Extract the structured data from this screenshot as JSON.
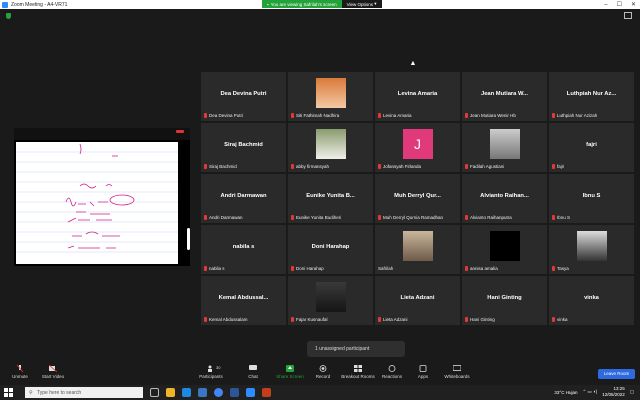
{
  "window": {
    "title": "Zoom Meeting - A4-VR71"
  },
  "banner": {
    "viewing": "You are viewing Safrilah's screen",
    "view_options": "View Options"
  },
  "participants": [
    {
      "tile": "Dea Devina Putri",
      "caption": "Dea Devina Putri",
      "muted": true
    },
    {
      "tile": "",
      "caption": "Siti Fathimah Nadhira",
      "muted": true,
      "photo": "anime"
    },
    {
      "tile": "Levina Amaria",
      "caption": "Levina Amaria",
      "muted": true
    },
    {
      "tile": "Jean Mutiara W...",
      "caption": "Jean Mutiara Wenir Hb",
      "muted": true
    },
    {
      "tile": "Luthpiah Nur Az...",
      "caption": "Luthpiah Nur Azizah",
      "muted": true
    },
    {
      "tile": "Siraj Bachmid",
      "caption": "Siraj Bachmid",
      "muted": true
    },
    {
      "tile": "",
      "caption": "abby firmansyah",
      "muted": true,
      "photo": "person"
    },
    {
      "tile": "",
      "caption": "Jofansyah Firlanda",
      "muted": true,
      "photo": "letter",
      "letter": "J"
    },
    {
      "tile": "",
      "caption": "Fadilah Agustiani",
      "muted": true,
      "photo": "room"
    },
    {
      "tile": "fajri",
      "caption": "fajri",
      "muted": true
    },
    {
      "tile": "Andri Darmawan",
      "caption": "Andri Darmawan",
      "muted": true
    },
    {
      "tile": "Eunike Yunita B...",
      "caption": "Eunike Yunita Budiheri",
      "muted": true
    },
    {
      "tile": "Muh Derryl Qur...",
      "caption": "Muh Derryl Qurnia Ramadhan",
      "muted": true
    },
    {
      "tile": "Alvianto Raihan...",
      "caption": "Alvianto Raihanputra",
      "muted": true
    },
    {
      "tile": "Ibnu S",
      "caption": "Ibnu S",
      "muted": true
    },
    {
      "tile": "nabila s",
      "caption": "nabila s",
      "muted": true
    },
    {
      "tile": "Doni Harahap",
      "caption": "Doni Harahap",
      "muted": true
    },
    {
      "tile": "",
      "caption": "Safrilah",
      "muted": false,
      "photo": "street"
    },
    {
      "tile": "",
      "caption": "annisa amalia",
      "muted": true,
      "photo": "black"
    },
    {
      "tile": "",
      "caption": "Tasya",
      "muted": true,
      "photo": "group"
    },
    {
      "tile": "Kemal Abdussal...",
      "caption": "Kemal Abdussalam",
      "muted": true
    },
    {
      "tile": "",
      "caption": "Fajar Kusnaufal",
      "muted": true,
      "photo": "dark"
    },
    {
      "tile": "Lieta Adzani",
      "caption": "Lieta Adzani",
      "muted": true
    },
    {
      "tile": "Hani Ginting",
      "caption": "Hani Ginting",
      "muted": true
    },
    {
      "tile": "vinka",
      "caption": "vinka",
      "muted": true
    }
  ],
  "popup": {
    "text": "1 unassigned participant"
  },
  "toolbar": {
    "unmute": "Unmute",
    "start_video": "Start Video",
    "participants": "Participants",
    "participants_count": "30",
    "chat": "Chat",
    "share_screen": "Share Screen",
    "record": "Record",
    "breakout_rooms": "Breakout Rooms",
    "reactions": "Reactions",
    "apps": "Apps",
    "whiteboards": "Whiteboards",
    "leave": "Leave Room"
  },
  "taskbar": {
    "search_placeholder": "Type here to search",
    "weather": "33°C Hujan",
    "time": "13:25",
    "date": "12/05/2022"
  },
  "colors": {
    "accent": "#2d8cff",
    "green": "#23a23a",
    "leave": "#2d6ae0",
    "muted": "#e23838"
  }
}
